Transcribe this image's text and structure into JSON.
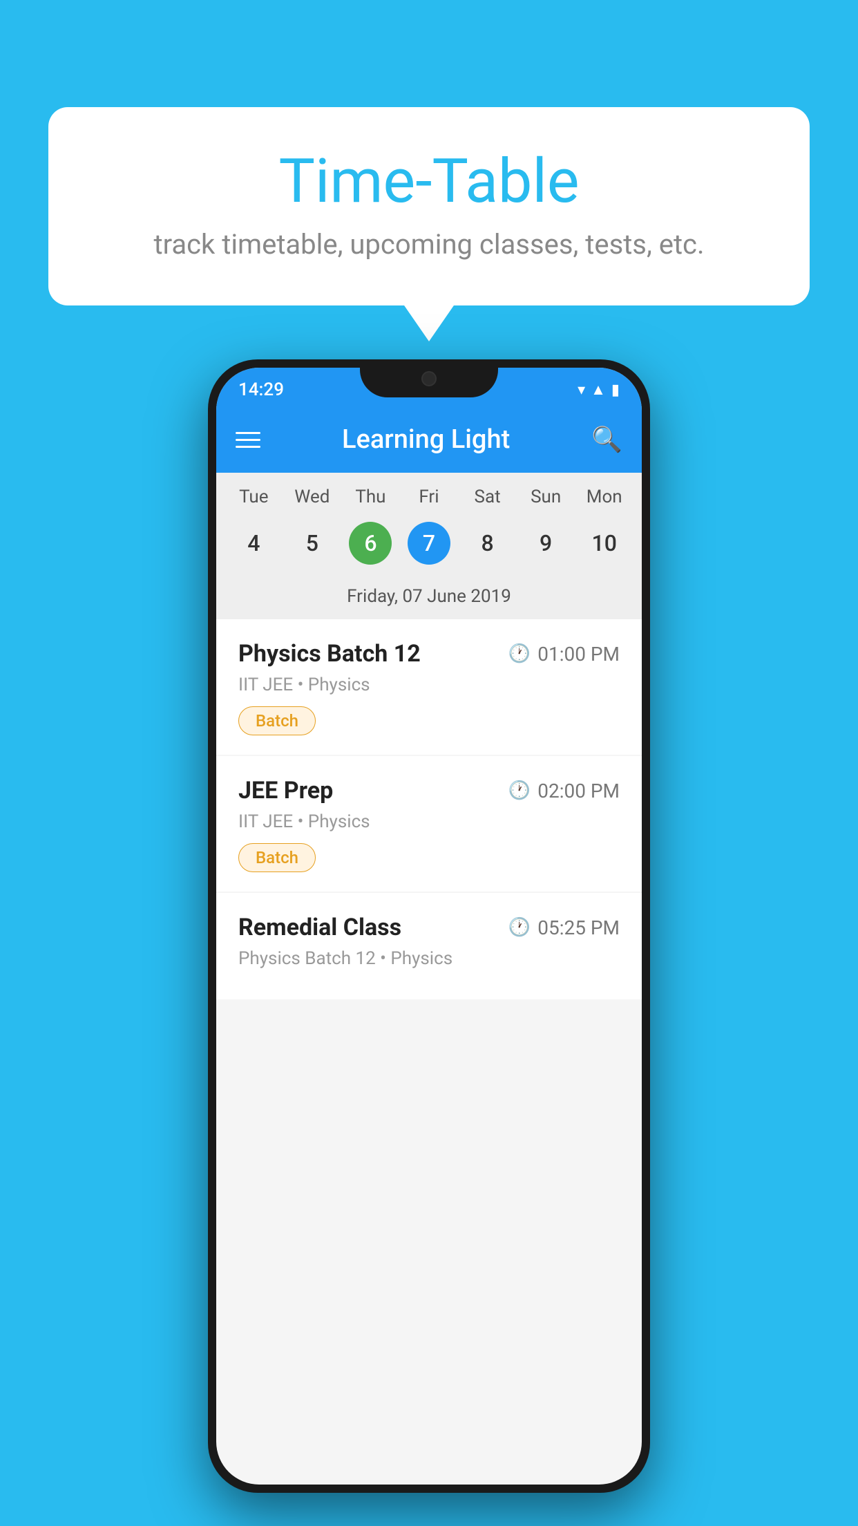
{
  "background_color": "#29BBEF",
  "bubble": {
    "title": "Time-Table",
    "subtitle": "track timetable, upcoming classes, tests, etc."
  },
  "phone": {
    "status_bar": {
      "time": "14:29"
    },
    "app_bar": {
      "title": "Learning Light"
    },
    "calendar": {
      "days": [
        "Tue",
        "Wed",
        "Thu",
        "Fri",
        "Sat",
        "Sun",
        "Mon"
      ],
      "dates": [
        {
          "num": "4",
          "state": "normal"
        },
        {
          "num": "5",
          "state": "normal"
        },
        {
          "num": "6",
          "state": "today"
        },
        {
          "num": "7",
          "state": "selected"
        },
        {
          "num": "8",
          "state": "normal"
        },
        {
          "num": "9",
          "state": "normal"
        },
        {
          "num": "10",
          "state": "normal"
        }
      ],
      "selected_date": "Friday, 07 June 2019"
    },
    "schedule": [
      {
        "title": "Physics Batch 12",
        "time": "01:00 PM",
        "subtitle": "IIT JEE • Physics",
        "badge": "Batch"
      },
      {
        "title": "JEE Prep",
        "time": "02:00 PM",
        "subtitle": "IIT JEE • Physics",
        "badge": "Batch"
      },
      {
        "title": "Remedial Class",
        "time": "05:25 PM",
        "subtitle": "Physics Batch 12 • Physics",
        "badge": null
      }
    ]
  }
}
